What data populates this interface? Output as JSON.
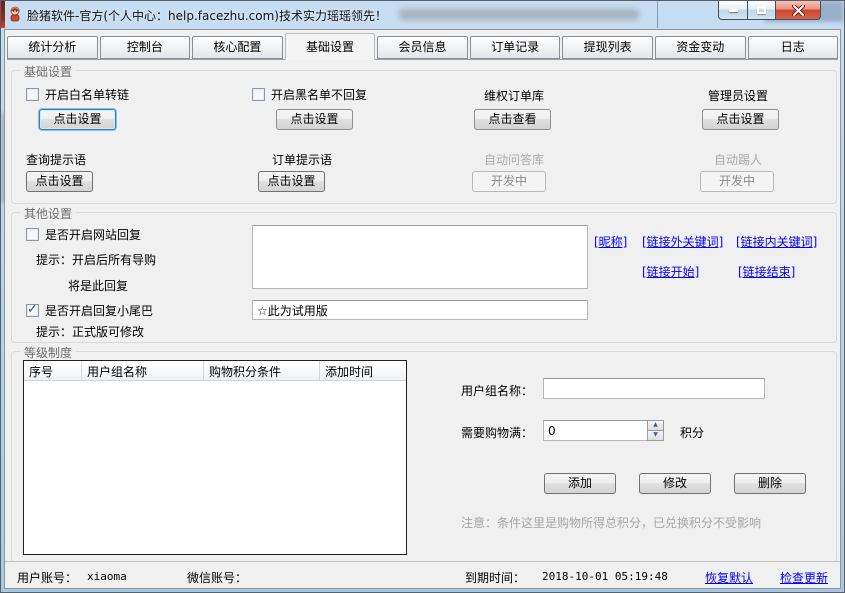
{
  "window": {
    "title": "脸猪软件-官方(个人中心：help.facezhu.com)技术实力瑶瑶领先！"
  },
  "tabs": [
    {
      "label": "统计分析",
      "active": false
    },
    {
      "label": "控制台",
      "active": false
    },
    {
      "label": "核心配置",
      "active": false
    },
    {
      "label": "基础设置",
      "active": true
    },
    {
      "label": "会员信息",
      "active": false
    },
    {
      "label": "订单记录",
      "active": false
    },
    {
      "label": "提现列表",
      "active": false
    },
    {
      "label": "资金变动",
      "active": false
    },
    {
      "label": "日志",
      "active": false
    }
  ],
  "basic_group": {
    "title": "基础设置",
    "white_list": {
      "label": "开启白名单转链",
      "checked": false,
      "button": "点击设置"
    },
    "black_list": {
      "label": "开启黑名单不回复",
      "checked": false,
      "button": "点击设置"
    },
    "rights_orders": {
      "label": "维权订单库",
      "button": "点击查看"
    },
    "admin": {
      "label": "管理员设置",
      "button": "点击设置"
    },
    "query_tip": {
      "label": "查询提示语",
      "button": "点击设置"
    },
    "order_tip": {
      "label": "订单提示语",
      "button": "点击设置"
    },
    "auto_qa": {
      "label": "自动问答库",
      "button": "开发中",
      "disabled": true
    },
    "auto_kick": {
      "label": "自动踢人",
      "button": "开发中",
      "disabled": true
    }
  },
  "other_group": {
    "title": "其他设置",
    "site_reply": {
      "label": "是否开启网站回复",
      "checked": false,
      "tip_line1": "提示：开启后所有导购",
      "tip_line2": "将是此回复",
      "textarea_value": ""
    },
    "links": {
      "nickname": "[昵称]",
      "out_keyword": "[链接外关键词]",
      "in_keyword": "[链接内关键词]",
      "link_start": "[链接开始]",
      "link_end": "[链接结束]"
    },
    "tail": {
      "label": "是否开启回复小尾巴",
      "checked": true,
      "value": "☆此为试用版",
      "tip": "提示：正式版可修改"
    }
  },
  "level_group": {
    "title": "等级制度",
    "table_headers": [
      "序号",
      "用户组名称",
      "购物积分条件",
      "添加时间"
    ],
    "group_name_label": "用户组名称：",
    "group_name_value": "",
    "points_label": "需要购物满：",
    "points_value": "0",
    "points_unit": "积分",
    "add_button": "添加",
    "modify_button": "修改",
    "delete_button": "删除",
    "note": "注意：条件这里是购物所得总积分，已兑换积分不受影响"
  },
  "status_bar": {
    "account_label": "用户账号：",
    "account_value": "xiaoma",
    "wechat_label": "微信账号：",
    "expire_label": "到期时间：",
    "expire_value": "2018-10-01 05:19:48",
    "restore_link": "恢复默认",
    "update_link": "检查更新"
  },
  "icons": {
    "checkmark": "✓",
    "spin_up": "▲",
    "spin_down": "▼"
  },
  "colors": {
    "link_blue": "#0000ff",
    "titlebar_blue": "#b7d1ea",
    "close_red": "#cc4732",
    "client_gray": "#f0f0f0"
  }
}
